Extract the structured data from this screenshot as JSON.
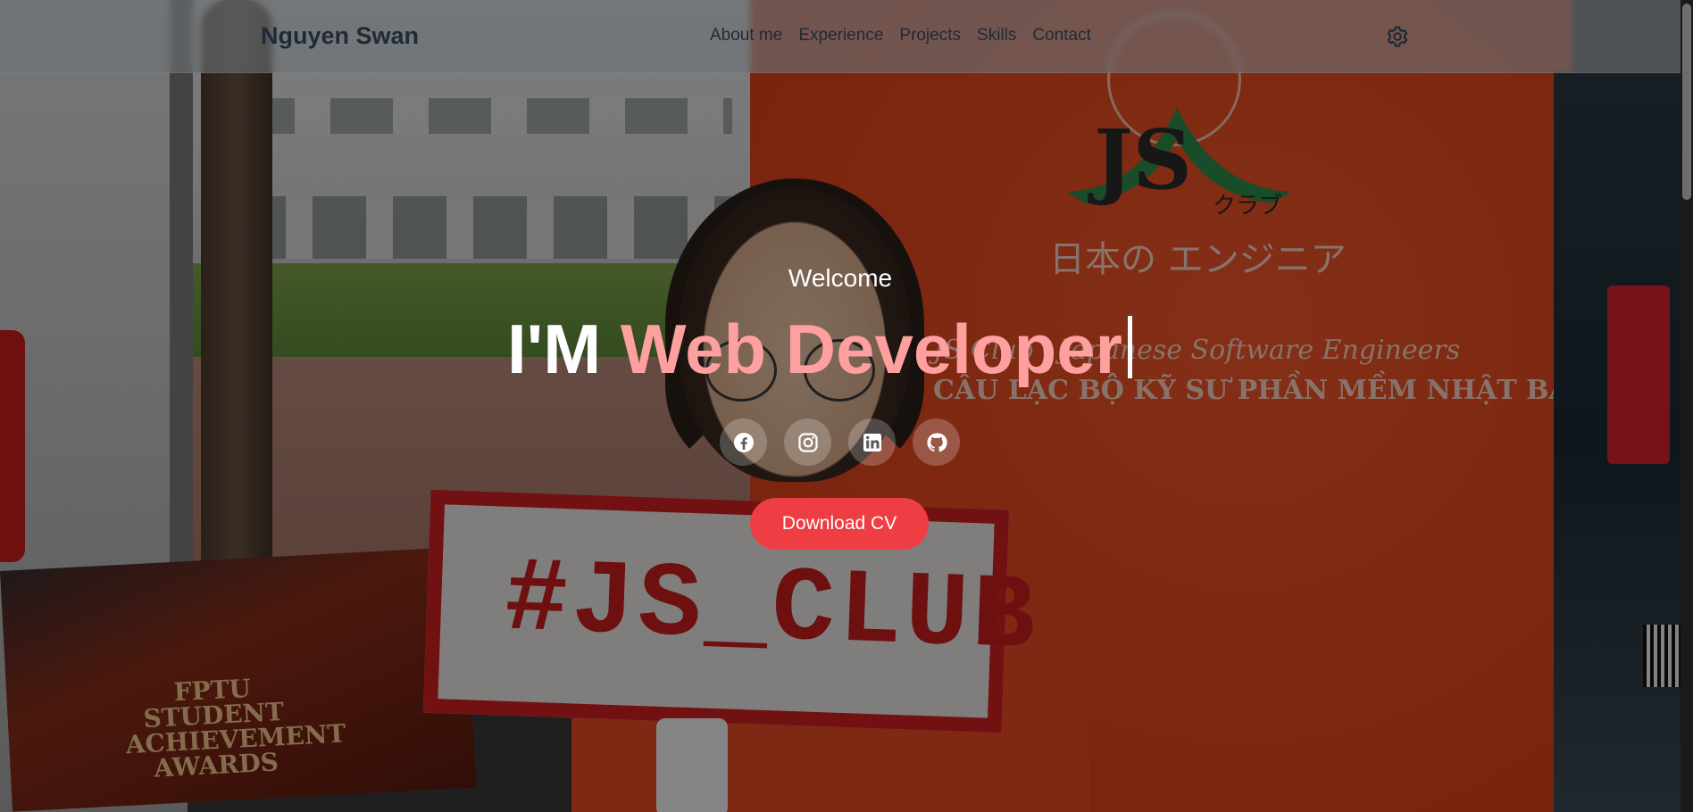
{
  "brand": {
    "name": "Nguyen Swan"
  },
  "nav": {
    "items": [
      {
        "label": "About me"
      },
      {
        "label": "Experience"
      },
      {
        "label": "Projects"
      },
      {
        "label": "Skills"
      },
      {
        "label": "Contact"
      }
    ],
    "settings_icon": "gear-icon"
  },
  "hero": {
    "welcome": "Welcome",
    "headline_prefix": "I'M ",
    "headline_role": "Web Developer",
    "download_label": "Download CV",
    "socials": [
      {
        "icon": "facebook-icon"
      },
      {
        "icon": "instagram-icon"
      },
      {
        "icon": "linkedin-icon"
      },
      {
        "icon": "github-icon"
      }
    ]
  },
  "background_photo": {
    "banner_line1": "JS Club · Japanese Software Engineers",
    "banner_line2": "CÂU LẠC BỘ KỸ SƯ PHẦN MỀM NHẬT BẢN",
    "banner_jp": "日本の エンジニア",
    "banner_logo": "JS",
    "banner_logo_kana": "クラブ",
    "sign_text": "#JS_CLUB",
    "board_text": "FPTU STUDENT ACHIEVEMENT AWARDS"
  },
  "colors": {
    "accent": "#ee3d43",
    "role_text": "#ffa0a0",
    "nav_text": "#1f2a36"
  }
}
